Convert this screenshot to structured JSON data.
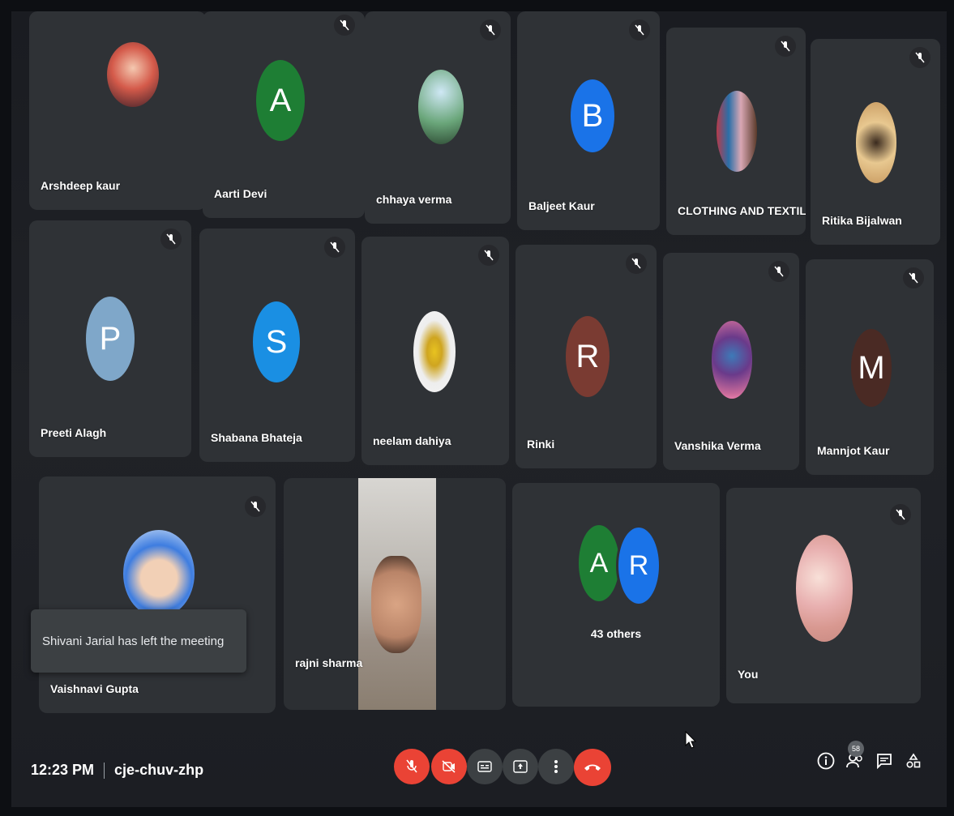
{
  "participants": [
    {
      "name": "Arshdeep kaur",
      "avatar_type": "photo",
      "muted": false
    },
    {
      "name": "Aarti Devi",
      "avatar_type": "letter",
      "letter": "A",
      "color": "#1e7e34",
      "muted": true
    },
    {
      "name": "chhaya verma",
      "avatar_type": "photo",
      "muted": true
    },
    {
      "name": "Baljeet Kaur",
      "avatar_type": "letter",
      "letter": "B",
      "color": "#1a73e8",
      "muted": true
    },
    {
      "name": "CLOTHING AND TEXTILES",
      "avatar_type": "photo",
      "muted": true
    },
    {
      "name": "Ritika Bijalwan",
      "avatar_type": "photo",
      "muted": true
    },
    {
      "name": "Preeti Alagh",
      "avatar_type": "letter",
      "letter": "P",
      "color": "#7fa7c9",
      "muted": true
    },
    {
      "name": "Shabana Bhateja",
      "avatar_type": "letter",
      "letter": "S",
      "color": "#1a8fe3",
      "muted": true
    },
    {
      "name": "neelam dahiya",
      "avatar_type": "photo",
      "muted": true
    },
    {
      "name": "Rinki",
      "avatar_type": "letter",
      "letter": "R",
      "color": "#7a3b32",
      "muted": true
    },
    {
      "name": "Vanshika Verma",
      "avatar_type": "photo",
      "muted": true
    },
    {
      "name": "Mannjot Kaur",
      "avatar_type": "letter",
      "letter": "M",
      "color": "#4a2a24",
      "muted": true
    },
    {
      "name": "Vaishnavi Gupta",
      "avatar_type": "photo",
      "muted": true
    },
    {
      "name": "rajni sharma",
      "avatar_type": "video",
      "muted": false
    },
    {
      "name": "43 others",
      "avatar_type": "group",
      "letters": [
        "A",
        "R"
      ],
      "colors": [
        "#1e7e34",
        "#1a73e8"
      ],
      "muted": false
    },
    {
      "name": "You",
      "avatar_type": "photo",
      "muted": true
    }
  ],
  "notification": {
    "text": "Shivani Jarial has left the meeting"
  },
  "bottom_bar": {
    "time": "12:23 PM",
    "meeting_code": "cje-chuv-zhp",
    "controls": [
      {
        "name": "microphone-off",
        "icon": "mic-off-icon",
        "color": "#ea4335"
      },
      {
        "name": "camera-off",
        "icon": "camera-off-icon",
        "color": "#ea4335"
      },
      {
        "name": "captions",
        "icon": "captions-icon",
        "color": "#3c4043"
      },
      {
        "name": "present",
        "icon": "present-icon",
        "color": "#3c4043"
      },
      {
        "name": "more-options",
        "icon": "more-vert-icon",
        "color": "#3c4043"
      },
      {
        "name": "leave-call",
        "icon": "call-end-icon",
        "color": "#ea4335"
      }
    ],
    "right_icons": [
      {
        "name": "meeting-details",
        "icon": "info-icon"
      },
      {
        "name": "people",
        "icon": "people-icon",
        "badge": "58"
      },
      {
        "name": "chat",
        "icon": "chat-icon"
      },
      {
        "name": "activities",
        "icon": "activities-icon"
      }
    ]
  }
}
